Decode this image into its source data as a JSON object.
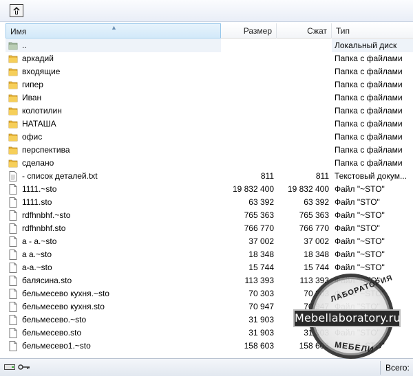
{
  "toolbar": {
    "up_button_icon": "up-arrow-icon"
  },
  "header": {
    "name": "Имя",
    "size": "Размер",
    "packed": "Сжат",
    "type": "Тип"
  },
  "rows": [
    {
      "kind": "parent",
      "icon": "parent-folder-icon",
      "name": "..",
      "size": "",
      "packed": "",
      "type": "Локальный диск"
    },
    {
      "kind": "folder",
      "icon": "folder-icon",
      "name": "аркадий",
      "size": "",
      "packed": "",
      "type": "Папка с файлами"
    },
    {
      "kind": "folder",
      "icon": "folder-icon",
      "name": "входящие",
      "size": "",
      "packed": "",
      "type": "Папка с файлами"
    },
    {
      "kind": "folder",
      "icon": "folder-icon",
      "name": "гипер",
      "size": "",
      "packed": "",
      "type": "Папка с файлами"
    },
    {
      "kind": "folder",
      "icon": "folder-icon",
      "name": "Иван",
      "size": "",
      "packed": "",
      "type": "Папка с файлами"
    },
    {
      "kind": "folder",
      "icon": "folder-icon",
      "name": "колотилин",
      "size": "",
      "packed": "",
      "type": "Папка с файлами"
    },
    {
      "kind": "folder",
      "icon": "folder-icon",
      "name": "НАТАША",
      "size": "",
      "packed": "",
      "type": "Папка с файлами"
    },
    {
      "kind": "folder",
      "icon": "folder-icon",
      "name": "офис",
      "size": "",
      "packed": "",
      "type": "Папка с файлами"
    },
    {
      "kind": "folder",
      "icon": "folder-icon",
      "name": "перспектива",
      "size": "",
      "packed": "",
      "type": "Папка с файлами"
    },
    {
      "kind": "folder",
      "icon": "folder-icon",
      "name": "сделано",
      "size": "",
      "packed": "",
      "type": "Папка с файлами"
    },
    {
      "kind": "file",
      "icon": "text-file-icon",
      "name": "- список деталей.txt",
      "size": "811",
      "packed": "811",
      "type": "Текстовый докум..."
    },
    {
      "kind": "file",
      "icon": "file-icon",
      "name": "1111.~sto",
      "size": "19 832 400",
      "packed": "19 832 400",
      "type": "Файл \"~STO\""
    },
    {
      "kind": "file",
      "icon": "file-icon",
      "name": "1111.sto",
      "size": "63 392",
      "packed": "63 392",
      "type": "Файл \"STO\""
    },
    {
      "kind": "file",
      "icon": "file-icon",
      "name": "rdfhnbhf.~sto",
      "size": "765 363",
      "packed": "765 363",
      "type": "Файл \"~STO\""
    },
    {
      "kind": "file",
      "icon": "file-icon",
      "name": "rdfhnbhf.sto",
      "size": "766 770",
      "packed": "766 770",
      "type": "Файл \"STO\""
    },
    {
      "kind": "file",
      "icon": "file-icon",
      "name": "а - а.~sto",
      "size": "37 002",
      "packed": "37 002",
      "type": "Файл \"~STO\""
    },
    {
      "kind": "file",
      "icon": "file-icon",
      "name": "а а.~sto",
      "size": "18 348",
      "packed": "18 348",
      "type": "Файл \"~STO\""
    },
    {
      "kind": "file",
      "icon": "file-icon",
      "name": "а-а.~sto",
      "size": "15 744",
      "packed": "15 744",
      "type": "Файл \"~STO\""
    },
    {
      "kind": "file",
      "icon": "file-icon",
      "name": "балясина.sto",
      "size": "113 393",
      "packed": "113 393",
      "type": "Файл \"STO\""
    },
    {
      "kind": "file",
      "icon": "file-icon",
      "name": "бельмесево кухня.~sto",
      "size": "70 303",
      "packed": "70 303",
      "type": "Файл \"~STO\""
    },
    {
      "kind": "file",
      "icon": "file-icon",
      "name": "бельмесево кухня.sto",
      "size": "70 947",
      "packed": "70 947",
      "type": "Файл \"STO\""
    },
    {
      "kind": "file",
      "icon": "file-icon",
      "name": "бельмесево.~sto",
      "size": "31 903",
      "packed": "31 903",
      "type": "Файл \"~STO\""
    },
    {
      "kind": "file",
      "icon": "file-icon",
      "name": "бельмесево.sto",
      "size": "31 903",
      "packed": "31 903",
      "type": "Файл \"STO\""
    },
    {
      "kind": "file",
      "icon": "file-icon",
      "name": "бельмесево1.~sto",
      "size": "158 603",
      "packed": "158 603",
      "type": "Файл \"~STO\""
    }
  ],
  "status": {
    "left_icons": [
      "drive-icon",
      "key-icon"
    ],
    "total_label": "Всего:"
  },
  "watermark": {
    "banner": "Mebellaboratory.ru",
    "top_text": "ЛАБОРАТОРИЯ",
    "bottom_text": "МЕБЕЛИ"
  }
}
